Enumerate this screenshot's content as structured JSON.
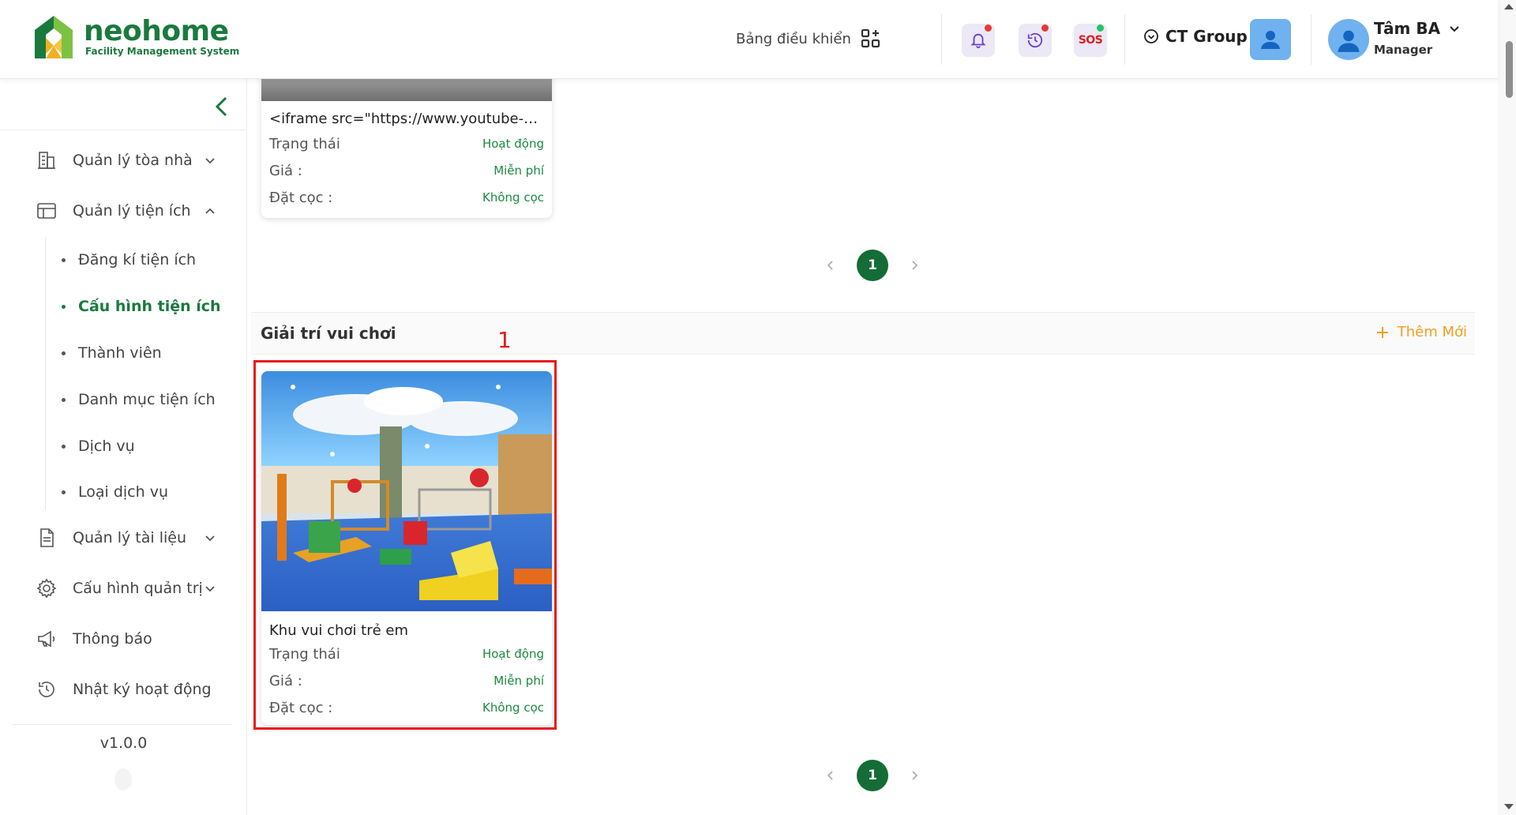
{
  "brand": {
    "name_part1": "neo",
    "name_part2": "home",
    "subtitle": "Facility Management System",
    "color": "#1a7a3e"
  },
  "header": {
    "dashboard_label": "Bảng điều khiển",
    "sos_label": "SOS",
    "org_name": "CT Group",
    "user_name": "Tâm BA",
    "user_role": "Manager",
    "notify_dot_color": "#e53935",
    "sos_dot_color": "#22c55e"
  },
  "sidebar": {
    "items": [
      {
        "label": "Quản lý tòa nhà",
        "icon": "building-icon"
      },
      {
        "label": "Quản lý tiện ích",
        "icon": "layout-icon"
      },
      {
        "label": "Quản lý tài liệu",
        "icon": "document-icon"
      },
      {
        "label": "Cấu hình quản trị",
        "icon": "gear-icon"
      },
      {
        "label": "Thông báo",
        "icon": "megaphone-icon"
      },
      {
        "label": "Nhật ký hoạt động",
        "icon": "history-icon"
      }
    ],
    "sub_items": [
      {
        "label": "Đăng kí tiện ích"
      },
      {
        "label": "Cấu hình tiện ích"
      },
      {
        "label": "Thành viên"
      },
      {
        "label": "Danh mục tiện ích"
      },
      {
        "label": "Dịch vụ"
      },
      {
        "label": "Loại dịch vụ"
      }
    ],
    "version": "v1.0.0"
  },
  "top_card": {
    "title": "<iframe src=\"https://www.youtube-n...",
    "status_label": "Trạng thái",
    "status_value": "Hoạt động",
    "price_label": "Giá :",
    "price_value": "Miễn phí",
    "deposit_label": "Đặt cọc :",
    "deposit_value": "Không cọc"
  },
  "pagination_top": {
    "page": "1"
  },
  "section": {
    "title": "Giải trí vui chơi",
    "add_label": "Thêm Mới",
    "annotation_number": "1"
  },
  "playground_card": {
    "title": "Khu vui chơi trẻ em",
    "status_label": "Trạng thái",
    "status_value": "Hoạt động",
    "price_label": "Giá :",
    "price_value": "Miễn phí",
    "deposit_label": "Đặt cọc :",
    "deposit_value": "Không cọc"
  },
  "pagination_bottom": {
    "page": "1"
  }
}
